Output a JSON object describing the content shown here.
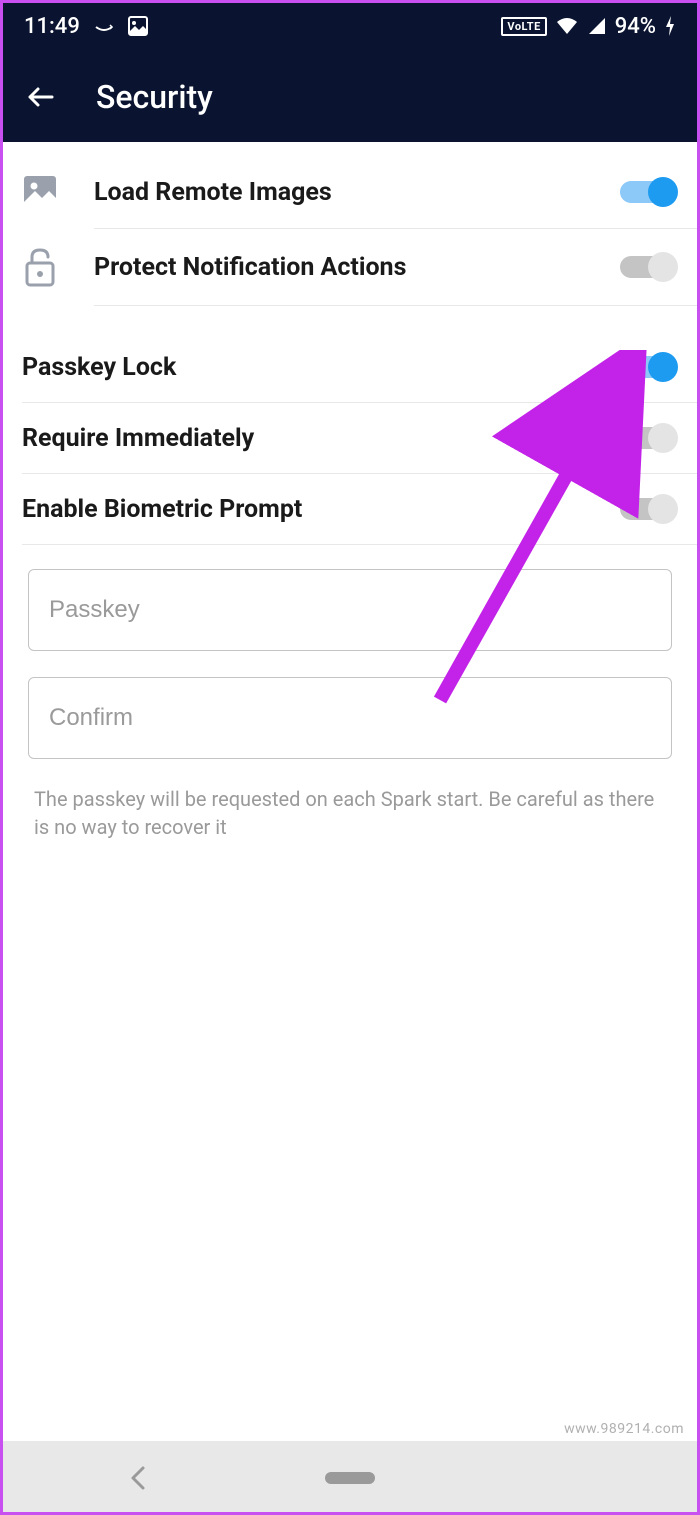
{
  "statusbar": {
    "time": "11:49",
    "volte": "VoLTE",
    "battery": "94%"
  },
  "appbar": {
    "title": "Security"
  },
  "settings": {
    "load_remote_images": {
      "label": "Load Remote Images",
      "on": true
    },
    "protect_notification_actions": {
      "label": "Protect Notification Actions",
      "on": false
    },
    "passkey_lock": {
      "label": "Passkey Lock",
      "on": true
    },
    "require_immediately": {
      "label": "Require Immediately",
      "on": false
    },
    "enable_biometric_prompt": {
      "label": "Enable Biometric Prompt",
      "on": false
    }
  },
  "form": {
    "passkey_placeholder": "Passkey",
    "confirm_placeholder": "Confirm",
    "hint": "The passkey will be requested on each Spark start. Be careful as there is no way to recover it"
  },
  "watermark": "www.989214.com"
}
